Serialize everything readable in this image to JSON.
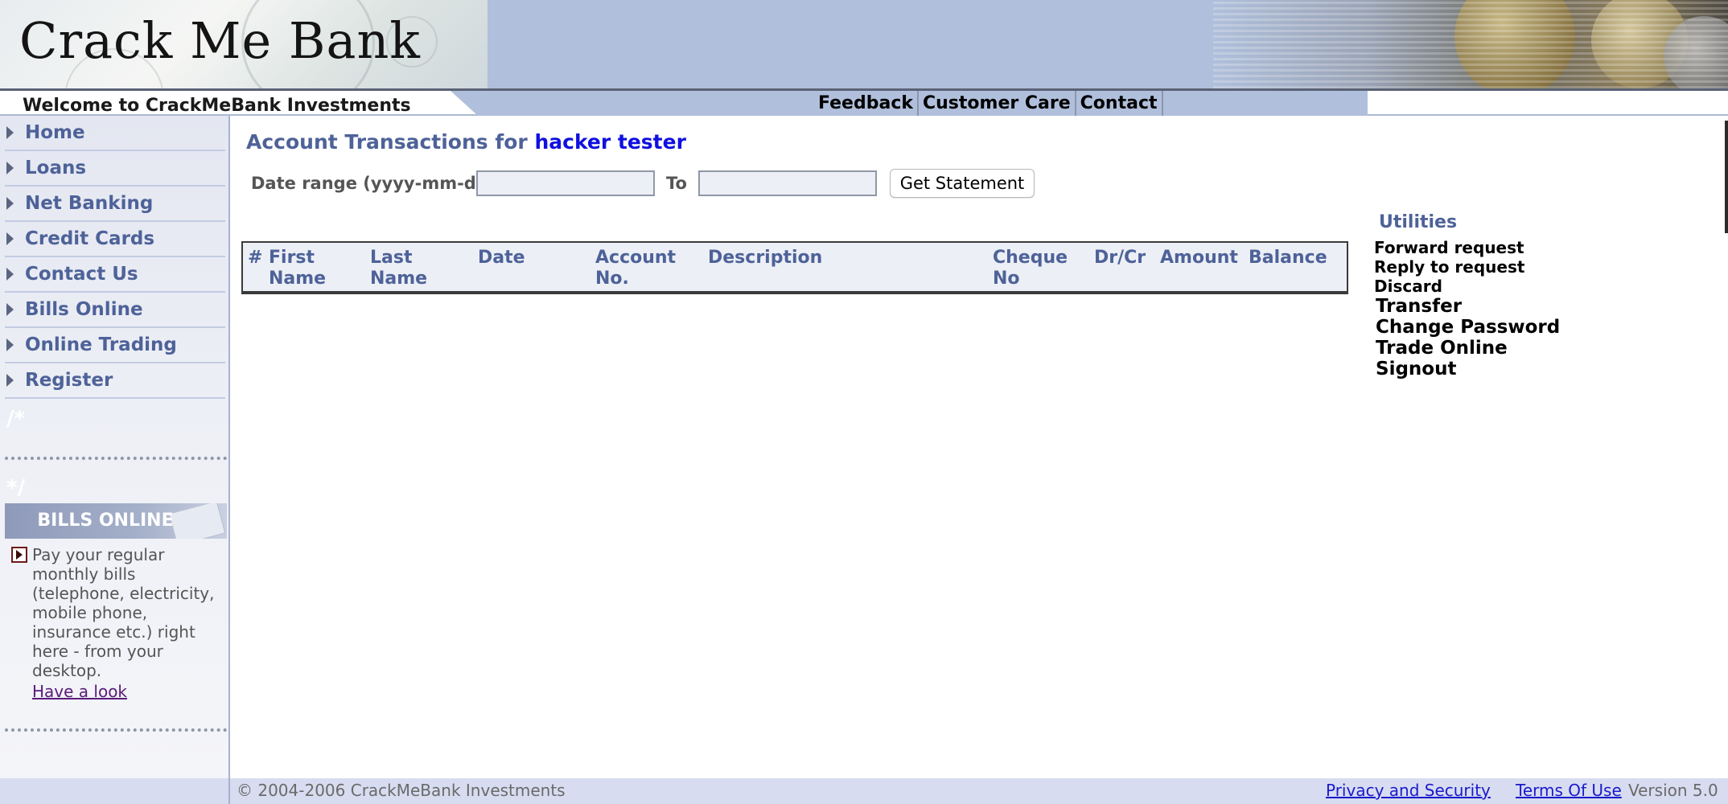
{
  "header": {
    "logo_text": "Crack Me Bank",
    "welcome": "Welcome to CrackMeBank Investments",
    "links": [
      "Feedback",
      "Customer Care",
      "Contact"
    ]
  },
  "sidebar": {
    "items": [
      {
        "label": "Home",
        "icon": "chevron-right-icon"
      },
      {
        "label": "Loans",
        "icon": "chevron-right-icon"
      },
      {
        "label": "Net Banking",
        "icon": "chevron-right-icon"
      },
      {
        "label": "Credit Cards",
        "icon": "chevron-right-icon"
      },
      {
        "label": "Contact Us",
        "icon": "chevron-right-icon"
      },
      {
        "label": "Bills Online",
        "icon": "chevron-right-icon"
      },
      {
        "label": "Online Trading",
        "icon": "chevron-right-icon"
      },
      {
        "label": "Register",
        "icon": "chevron-right-icon"
      }
    ],
    "comment_open": "/*",
    "comment_close": "*/",
    "promo": {
      "banner": "BILLS ONLINE",
      "text": "Pay your regular monthly bills (telephone, electricity, mobile phone, insurance etc.) right here - from your desktop.",
      "link": "Have a look"
    }
  },
  "main": {
    "title_prefix": "Account Transactions for",
    "user_name": "hacker tester",
    "date_range_label": "Date range (yyyy-mm-dd)",
    "from_value": "",
    "to_label": "To",
    "to_value": "",
    "get_statement": "Get Statement",
    "table": {
      "columns": [
        {
          "line1": "#",
          "line2": ""
        },
        {
          "line1": "First",
          "line2": "Name"
        },
        {
          "line1": "Last",
          "line2": "Name"
        },
        {
          "line1": "Date",
          "line2": ""
        },
        {
          "line1": "Account",
          "line2": "No."
        },
        {
          "line1": "Description",
          "line2": ""
        },
        {
          "line1": "Cheque",
          "line2": "No"
        },
        {
          "line1": "Dr/Cr",
          "line2": ""
        },
        {
          "line1": "Amount",
          "line2": ""
        },
        {
          "line1": "Balance",
          "line2": ""
        }
      ],
      "rows": []
    }
  },
  "utilities": {
    "title": "Utilities",
    "items": [
      "Forward request",
      "Reply to request",
      "Discard",
      "Transfer",
      "Change Password",
      "Trade Online",
      "Signout"
    ]
  },
  "footer": {
    "copyright": "© 2004-2006 CrackMeBank Investments",
    "privacy": "Privacy and Security",
    "terms": "Terms Of Use",
    "version": "Version 5.0"
  },
  "colors": {
    "header_blue": "#b0bfdb",
    "nav_link": "#4e6299",
    "user_highlight": "#1010e0",
    "footer_bg": "#d7dcf0"
  }
}
